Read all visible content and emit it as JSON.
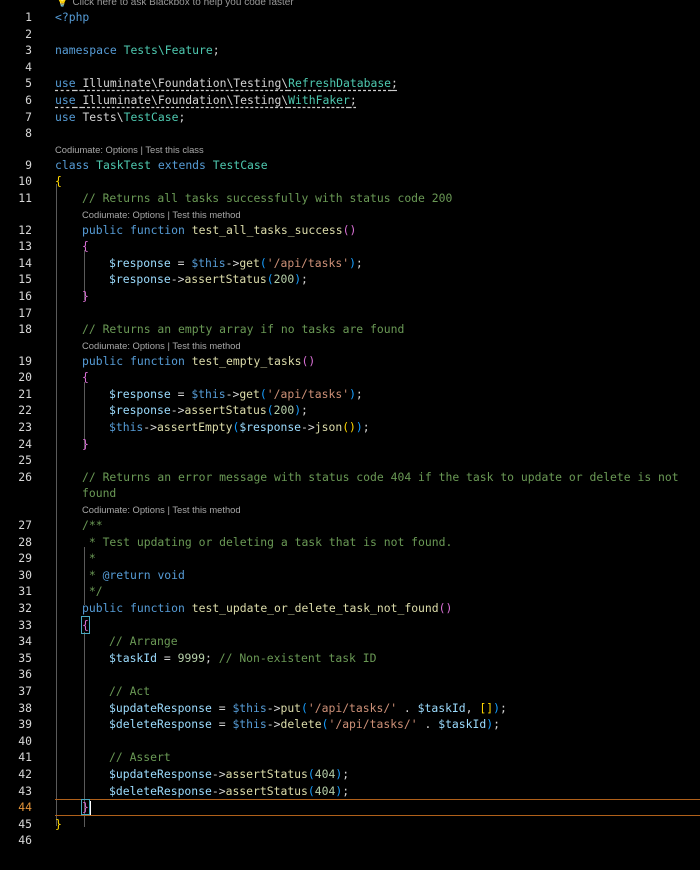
{
  "hint": {
    "icon": "lightbulb-icon",
    "text": "Click here to ask Blackbox to help you code faster"
  },
  "codelens": {
    "class": "Codiumate: Options | Test this class",
    "method": "Codiumate: Options | Test this method"
  },
  "active_line": 44,
  "lines": {
    "l1": "<?php",
    "l3a": "namespace",
    "l3b": "Tests\\Feature",
    "l5a": "use",
    "l5b": "Illuminate\\Foundation\\Testing\\",
    "l5c": "RefreshDatabase",
    "l6a": "use",
    "l6b": "Illuminate\\Foundation\\Testing\\",
    "l6c": "WithFaker",
    "l7a": "use",
    "l7b": "Tests\\",
    "l7c": "TestCase",
    "l9a": "class",
    "l9b": "TaskTest",
    "l9c": "extends",
    "l9d": "TestCase",
    "l11": "// Returns all tasks successfully with status code 200",
    "l12a": "public",
    "l12b": "function",
    "l12c": "test_all_tasks_success",
    "l14a": "$response",
    "l14b": "$this",
    "l14c": "get",
    "l14d": "'/api/tasks'",
    "l15a": "$response",
    "l15b": "assertStatus",
    "l15c": "200",
    "l18": "// Returns an empty array if no tasks are found",
    "l19a": "public",
    "l19b": "function",
    "l19c": "test_empty_tasks",
    "l21a": "$response",
    "l21b": "$this",
    "l21c": "get",
    "l21d": "'/api/tasks'",
    "l22a": "$response",
    "l22b": "assertStatus",
    "l22c": "200",
    "l23a": "$this",
    "l23b": "assertEmpty",
    "l23c": "$response",
    "l23d": "json",
    "l26": "// Returns an error message with status code 404 if the task to update or delete is not",
    "l26w": "found",
    "l27": "/**",
    "l28": " * Test updating or deleting a task that is not found.",
    "l29": " *",
    "l30a": " * ",
    "l30b": "@return",
    "l30c": "void",
    "l31": " */",
    "l32a": "public",
    "l32b": "function",
    "l32c": "test_update_or_delete_task_not_found",
    "l34": "// Arrange",
    "l35a": "$taskId",
    "l35b": "9999",
    "l35c": "// Non-existent task ID",
    "l37": "// Act",
    "l38a": "$updateResponse",
    "l38b": "$this",
    "l38c": "put",
    "l38d": "'/api/tasks/'",
    "l38e": "$taskId",
    "l39a": "$deleteResponse",
    "l39b": "$this",
    "l39c": "delete",
    "l39d": "'/api/tasks/'",
    "l39e": "$taskId",
    "l41": "// Assert",
    "l42a": "$updateResponse",
    "l42b": "assertStatus",
    "l42c": "404",
    "l43a": "$deleteResponse",
    "l43b": "assertStatus",
    "l43c": "404"
  },
  "line_numbers": [
    "1",
    "2",
    "3",
    "4",
    "5",
    "6",
    "7",
    "8",
    "9",
    "10",
    "11",
    "12",
    "13",
    "14",
    "15",
    "16",
    "17",
    "18",
    "19",
    "20",
    "21",
    "22",
    "23",
    "24",
    "25",
    "26",
    "27",
    "28",
    "29",
    "30",
    "31",
    "32",
    "33",
    "34",
    "35",
    "36",
    "37",
    "38",
    "39",
    "40",
    "41",
    "42",
    "43",
    "44",
    "45",
    "46"
  ]
}
